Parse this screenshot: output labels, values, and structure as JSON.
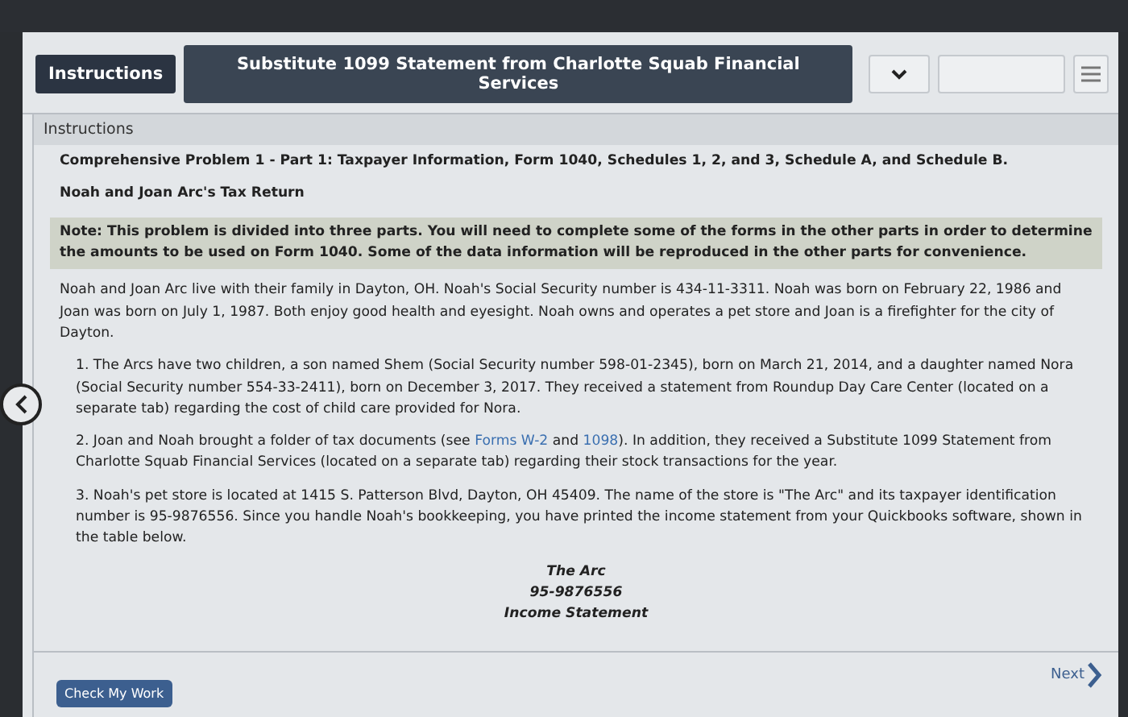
{
  "tabs": [
    {
      "label": "Instructions",
      "selected": true
    },
    {
      "label": "Substitute 1099 Statement from Charlotte Squab Financial Services",
      "selected": false
    }
  ],
  "section_header": "Instructions",
  "problem_title": "Comprehensive Problem 1 - Part 1: Taxpayer Information, Form 1040, Schedules 1, 2, and 3, Schedule A, and Schedule B.",
  "return_title": "Noah and Joan Arc's Tax Return",
  "note": "Note: This problem is divided into three parts. You will need to complete some of the forms in the other parts in order to determine the amounts to be used on Form 1040. Some of the data information will be reproduced in the other parts for convenience.",
  "intro": "Noah and Joan Arc live with their family in Dayton, OH. Noah's Social Security number is 434-11-3311. Noah was born on February 22, 1986 and Joan was born on July 1, 1987. Both enjoy good health and eyesight. Noah owns and operates a pet store and Joan is a firefighter for the city of Dayton.",
  "items": [
    [
      {
        "kind": "text",
        "text": "1. The Arcs have two children, a son named Shem (Social Security number 598-01-2345), born on March 21, 2014, and a daughter named Nora (Social Security number 554-33-2411), born on December 3, 2017. They received a statement from Roundup Day Care Center (located on a separate tab) regarding the cost of child care provided for Nora."
      }
    ],
    [
      {
        "kind": "text",
        "text": "2. Joan and Noah brought a folder of tax documents (see "
      },
      {
        "kind": "link",
        "text": "Forms W-2"
      },
      {
        "kind": "text",
        "text": " and "
      },
      {
        "kind": "link",
        "text": "1098"
      },
      {
        "kind": "text",
        "text": "). In addition, they received a Substitute 1099 Statement from Charlotte Squab Financial Services (located on a separate tab) regarding their stock transactions for the year."
      }
    ],
    [
      {
        "kind": "text",
        "text": "3. Noah's pet store is located at 1415 S. Patterson Blvd, Dayton, OH 45409. The name of the store is \"The Arc\" and its taxpayer identification number is 95-9876556. Since you handle Noah's bookkeeping, you have printed the income statement from your Quickbooks software, shown in the table below."
      }
    ]
  ],
  "statement_heading": [
    "The Arc",
    "95-9876556",
    "Income Statement"
  ],
  "check_button": "Check My Work",
  "next_link": "Next"
}
